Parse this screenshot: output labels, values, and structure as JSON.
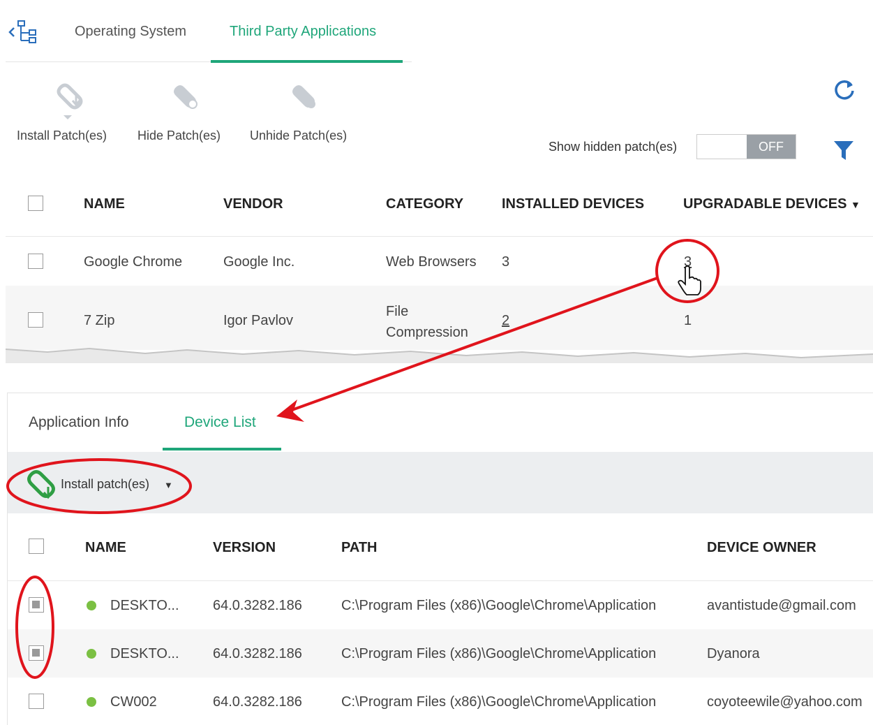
{
  "top_tabs": {
    "os_label": "Operating System",
    "third_party_label": "Third Party Applications"
  },
  "toolbar": {
    "install_label": "Install Patch(es)",
    "hide_label": "Hide Patch(es)",
    "unhide_label": "Unhide Patch(es)",
    "show_hidden_label": "Show hidden patch(es)",
    "toggle_state": "OFF"
  },
  "apps_table": {
    "headers": [
      "NAME",
      "VENDOR",
      "CATEGORY",
      "INSTALLED DEVICES",
      "UPGRADABLE DEVICES"
    ],
    "rows": [
      {
        "name": "Google Chrome",
        "vendor": "Google Inc.",
        "category": "Web Browsers",
        "category_2": "",
        "installed": "3",
        "upgradable": "3"
      },
      {
        "name": "7 Zip",
        "vendor": "Igor Pavlov",
        "category": "File",
        "category_2": "Compression",
        "installed": "2",
        "upgradable": "1"
      }
    ]
  },
  "detail_tabs": {
    "info_label": "Application Info",
    "device_list_label": "Device List"
  },
  "device_toolbar": {
    "install_label": "Install patch(es)"
  },
  "devices_table": {
    "headers": [
      "NAME",
      "VERSION",
      "PATH",
      "DEVICE OWNER"
    ],
    "rows": [
      {
        "name": "DESKTO...",
        "version": "64.0.3282.186",
        "path": "C:\\Program Files (x86)\\Google\\Chrome\\Application",
        "owner": "avantistude@gmail.com"
      },
      {
        "name": "DESKTO...",
        "version": "64.0.3282.186",
        "path": "C:\\Program Files (x86)\\Google\\Chrome\\Application",
        "owner": "Dyanora"
      },
      {
        "name": "CW002",
        "version": "64.0.3282.186",
        "path": "C:\\Program Files (x86)\\Google\\Chrome\\Application",
        "owner": "coyoteewile@yahoo.com"
      }
    ]
  },
  "colors": {
    "accent": "#1fa67a",
    "link": "#2a6ebb",
    "annotation": "#e0141c",
    "online_dot": "#7bc043"
  }
}
